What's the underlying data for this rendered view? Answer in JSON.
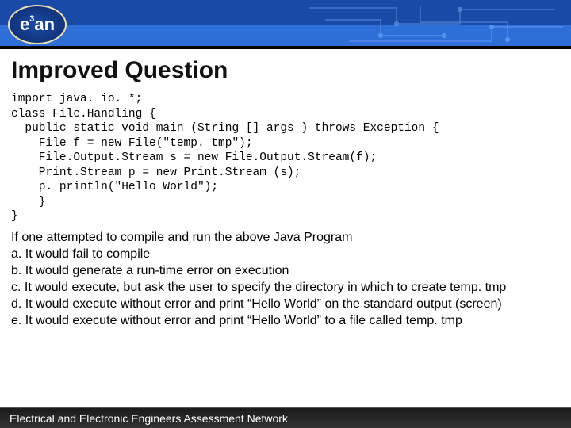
{
  "logo": {
    "text": "e",
    "sup": "3",
    "suffix": "an"
  },
  "title": "Improved Question",
  "code_lines": [
    "import java. io. *;",
    "class File.Handling {",
    "  public static void main (String [] args ) throws Exception {",
    "    File f = new File(\"temp. tmp\");",
    "    File.Output.Stream s = new File.Output.Stream(f);",
    "    Print.Stream p = new Print.Stream (s);",
    "    p. println(\"Hello World\");",
    "    }",
    "}"
  ],
  "question_stem": "If one attempted to compile and run the above Java Program",
  "options": [
    {
      "label": "a.",
      "text": "It would fail to compile"
    },
    {
      "label": "b.",
      "text": "It would generate a run-time error on execution"
    },
    {
      "label": "c.",
      "text": "It would execute, but ask the user to specify the directory in which to create temp. tmp"
    },
    {
      "label": "d.",
      "text": "It would execute without error and print “Hello World” on the standard output (screen)"
    },
    {
      "label": "e.",
      "text": "It would execute without error and print “Hello World” to a file called temp. tmp"
    }
  ],
  "footer": "Electrical and Electronic Engineers Assessment Network"
}
